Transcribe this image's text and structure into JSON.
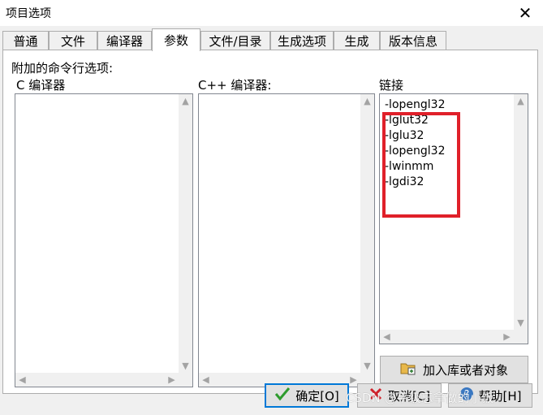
{
  "window": {
    "title": "项目选项",
    "close_glyph": "✕"
  },
  "tabs": [
    {
      "label": "普通"
    },
    {
      "label": "文件"
    },
    {
      "label": "编译器"
    },
    {
      "label": "参数"
    },
    {
      "label": "文件/目录"
    },
    {
      "label": "生成选项"
    },
    {
      "label": "生成"
    },
    {
      "label": "版本信息"
    }
  ],
  "active_tab": "参数",
  "params": {
    "heading": "附加的命令行选项:",
    "c_compiler": {
      "label": "C 编译器"
    },
    "cpp_compiler": {
      "label": "C++ 编译器:"
    },
    "linker": {
      "label": "链接",
      "items": [
        "-lopengl32",
        "-lglut32",
        "-lglu32",
        "-lopengl32",
        "-lwinmm",
        "-lgdi32"
      ]
    },
    "add_lib_button": "加入库或者对象"
  },
  "buttons": {
    "ok": "确定[O]",
    "cancel": "取消[C]",
    "help": "帮助[H]"
  },
  "watermark": "CSDN @平级忘拿做的小饭",
  "colors": {
    "highlight": "#e0202a",
    "ok_check": "#2e9b2e",
    "cancel_x": "#d0202a",
    "help": "#3a78c2"
  }
}
